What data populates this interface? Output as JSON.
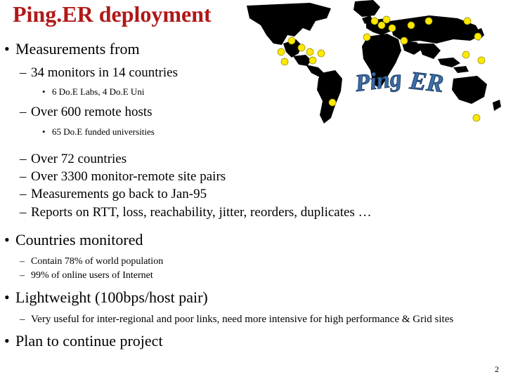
{
  "title": "Ping.ER deployment",
  "page_number": "2",
  "colors": {
    "title": "#b01818",
    "map_land": "#000000",
    "map_node": "#ffe800",
    "map_node_stroke": "#8a8a00",
    "logo_text": "#3a6ea8"
  },
  "map": {
    "name": "world-map-with-monitor-nodes",
    "logo_text": "Ping ER"
  },
  "content": [
    {
      "level": 1,
      "bullet": "•",
      "text": "Measurements from"
    },
    {
      "level": 2,
      "bullet": "–",
      "text": "34 monitors in 14 countries"
    },
    {
      "level": 3,
      "bullet": "•",
      "text": "6 Do.E Labs, 4 Do.E Uni"
    },
    {
      "level": 2,
      "bullet": "–",
      "text": "Over 600 remote hosts"
    },
    {
      "level": 3,
      "bullet": "•",
      "text": "65 Do.E funded universities"
    },
    {
      "level": 2,
      "bullet": "–",
      "text": "Over 72 countries"
    },
    {
      "level": 2,
      "bullet": "–",
      "text": "Over 3300 monitor-remote site pairs"
    },
    {
      "level": 2,
      "bullet": "–",
      "text": "Measurements go back to Jan-95"
    },
    {
      "level": 2,
      "bullet": "–",
      "text": "Reports on RTT, loss, reachability, jitter, reorders, duplicates …"
    },
    {
      "level": 1,
      "bullet": "•",
      "text": "Countries monitored"
    },
    {
      "level": 2,
      "bullet": "–",
      "text": "Contain 78% of world population"
    },
    {
      "level": 2,
      "bullet": "–",
      "text": "99% of online users of Internet"
    },
    {
      "level": 1,
      "bullet": "•",
      "text": "Lightweight (100bps/host pair)"
    },
    {
      "level": 2,
      "bullet": "–",
      "text": "Very useful for inter-regional and poor links, need more intensive for high performance & Grid sites"
    },
    {
      "level": 1,
      "bullet": "•",
      "text": "Plan to continue project"
    }
  ]
}
